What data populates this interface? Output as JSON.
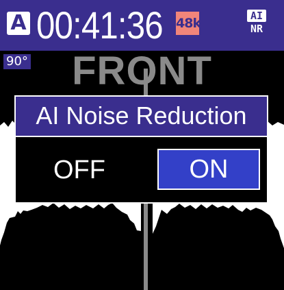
{
  "status_bar": {
    "mode_label": "A",
    "timecode": "00:41:36",
    "sample_rate_label": "48k",
    "ainr_icon": {
      "top": "AI",
      "bottom": "NR"
    }
  },
  "meter": {
    "angle_label": "90°",
    "direction_label": "FRONT"
  },
  "dialog": {
    "title": "AI Noise Reduction",
    "options": [
      {
        "label": "OFF",
        "selected": false
      },
      {
        "label": "ON",
        "selected": true
      }
    ]
  },
  "colors": {
    "accent": "#3a2e8e",
    "selected_option": "#3340c8",
    "rate_badge": "#f0857a",
    "front_text": "#8a8a8a"
  }
}
